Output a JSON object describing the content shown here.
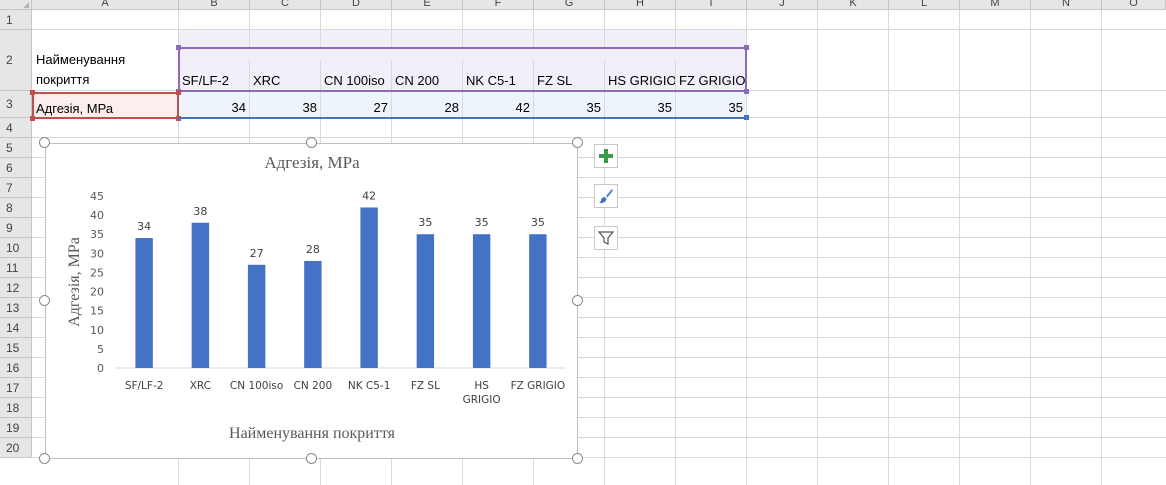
{
  "columns": [
    "A",
    "B",
    "C",
    "D",
    "E",
    "F",
    "G",
    "H",
    "I",
    "J",
    "K",
    "L",
    "M",
    "N",
    "O"
  ],
  "rows": [
    "1",
    "2",
    "3",
    "4",
    "5",
    "6",
    "7",
    "8",
    "9",
    "10",
    "11",
    "12",
    "13",
    "14",
    "15",
    "16",
    "17",
    "18",
    "19",
    "20"
  ],
  "table": {
    "name_header_line1": "Найменування",
    "name_header_line2": "покриття",
    "row_label": "Адгезія, МРа",
    "coatings": [
      "SF/LF-2",
      "XRC",
      "CN 100iso",
      "CN 200",
      "NK C5-1",
      "FZ SL",
      "HS GRIGIO",
      "FZ GRIGIO"
    ],
    "values": [
      "34",
      "38",
      "27",
      "28",
      "42",
      "35",
      "35",
      "35"
    ]
  },
  "colors": {
    "bar": "#4472c4",
    "series_name_range": "#8e6bb8",
    "category_range": "#c0504d",
    "values_range": "#4472c4",
    "add_element_icon": "#3c9b4a"
  },
  "chart_tools": {
    "add_element": "plus-icon",
    "style": "brush-icon",
    "filter": "filter-icon"
  },
  "chart_data": {
    "type": "bar",
    "title": "Адгезія, МРа",
    "xlabel": "Найменування покриття",
    "ylabel": "Адгезія, МРа",
    "categories": [
      "SF/LF-2",
      "XRC",
      "CN 100iso",
      "CN 200",
      "NK C5-1",
      "FZ SL",
      "HS GRIGIO",
      "FZ GRIGIO"
    ],
    "values": [
      34,
      38,
      27,
      28,
      42,
      35,
      35,
      35
    ],
    "ylim": [
      0,
      45
    ],
    "yticks": [
      0,
      5,
      10,
      15,
      20,
      25,
      30,
      35,
      40,
      45
    ],
    "grid": false,
    "legend": "none",
    "data_labels": true
  }
}
